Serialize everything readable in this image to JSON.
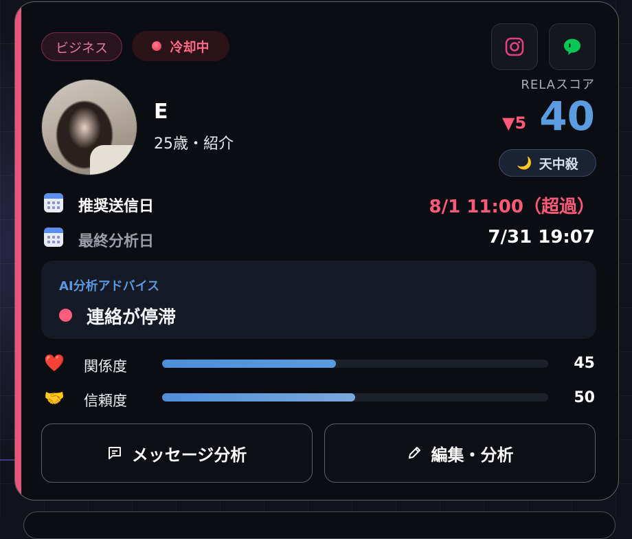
{
  "tags": {
    "category": "ビジネス",
    "status": "冷却中"
  },
  "profile": {
    "name": "E",
    "subtitle": "25歳・紹介"
  },
  "score": {
    "label": "RELAスコア",
    "value": "40",
    "delta": "▼5",
    "badge": "天中殺",
    "badge_icon": "🌙"
  },
  "dates": [
    {
      "label": "推奨送信日",
      "value": "8/1 11:00（超過）",
      "value_color": "#ff5a7a"
    },
    {
      "label": "最終分析日",
      "value": "7/31 19:07",
      "value_color": "#ffffff"
    }
  ],
  "advice": {
    "title": "AI分析アドバイス",
    "text": "連絡が停滞"
  },
  "metrics": [
    {
      "icon": "❤️",
      "label": "関係度",
      "value": "45",
      "fraction": 0.45,
      "color": "#4f8fd8"
    },
    {
      "icon": "🤝",
      "label": "信頼度",
      "value": "50",
      "fraction": 0.5,
      "color": "#5a92d6"
    }
  ],
  "actions": {
    "message": "メッセージ分析",
    "edit": "編集・分析"
  },
  "colors": {
    "accent": "#e8557a",
    "score": "#5b9be0",
    "advice_title": "#5a97e0",
    "line": "#06c755",
    "instagram": "#e4407a"
  },
  "icons": {
    "instagram": "instagram-icon",
    "line": "line-icon",
    "calendar": "calendar-icon",
    "message": "message-icon",
    "edit": "pencil-icon"
  }
}
